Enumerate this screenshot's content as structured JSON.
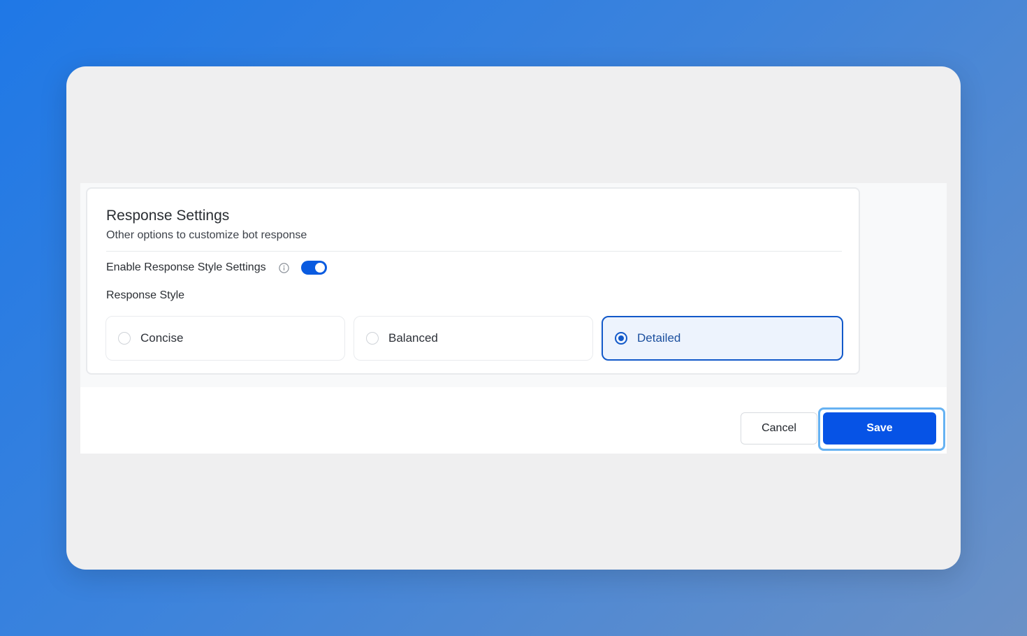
{
  "settings": {
    "title": "Response Settings",
    "subtitle": "Other options to customize bot response",
    "toggle": {
      "label": "Enable Response Style Settings",
      "enabled": true,
      "info_icon": "info-circle-icon"
    },
    "response_style": {
      "label": "Response Style",
      "options": [
        {
          "label": "Concise",
          "selected": false
        },
        {
          "label": "Balanced",
          "selected": false
        },
        {
          "label": "Detailed",
          "selected": true
        }
      ]
    }
  },
  "footer": {
    "cancel_label": "Cancel",
    "save_label": "Save"
  },
  "colors": {
    "accent": "#0653e6",
    "selected_border": "#1259c9",
    "selected_background": "#edf3fd",
    "focus_ring": "#66b2f2"
  }
}
